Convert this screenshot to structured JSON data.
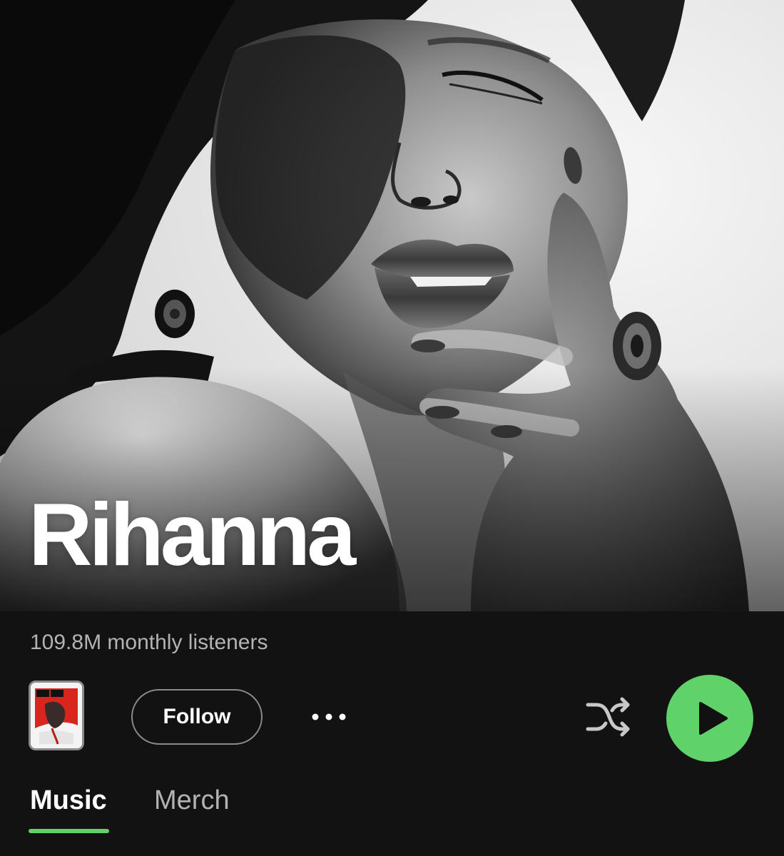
{
  "artist": {
    "name": "Rihanna",
    "monthly_listeners": "109.8M monthly listeners"
  },
  "actions": {
    "follow_label": "Follow",
    "more_icon": "more-horizontal-icon",
    "shuffle_icon": "shuffle-icon",
    "play_icon": "play-icon"
  },
  "tabs": [
    {
      "label": "Music",
      "active": true
    },
    {
      "label": "Merch",
      "active": false
    }
  ],
  "colors": {
    "background": "#121212",
    "accent_green": "#5fd26a",
    "secondary_text": "#b3b3b3",
    "border_gray": "#8a8a8a"
  }
}
